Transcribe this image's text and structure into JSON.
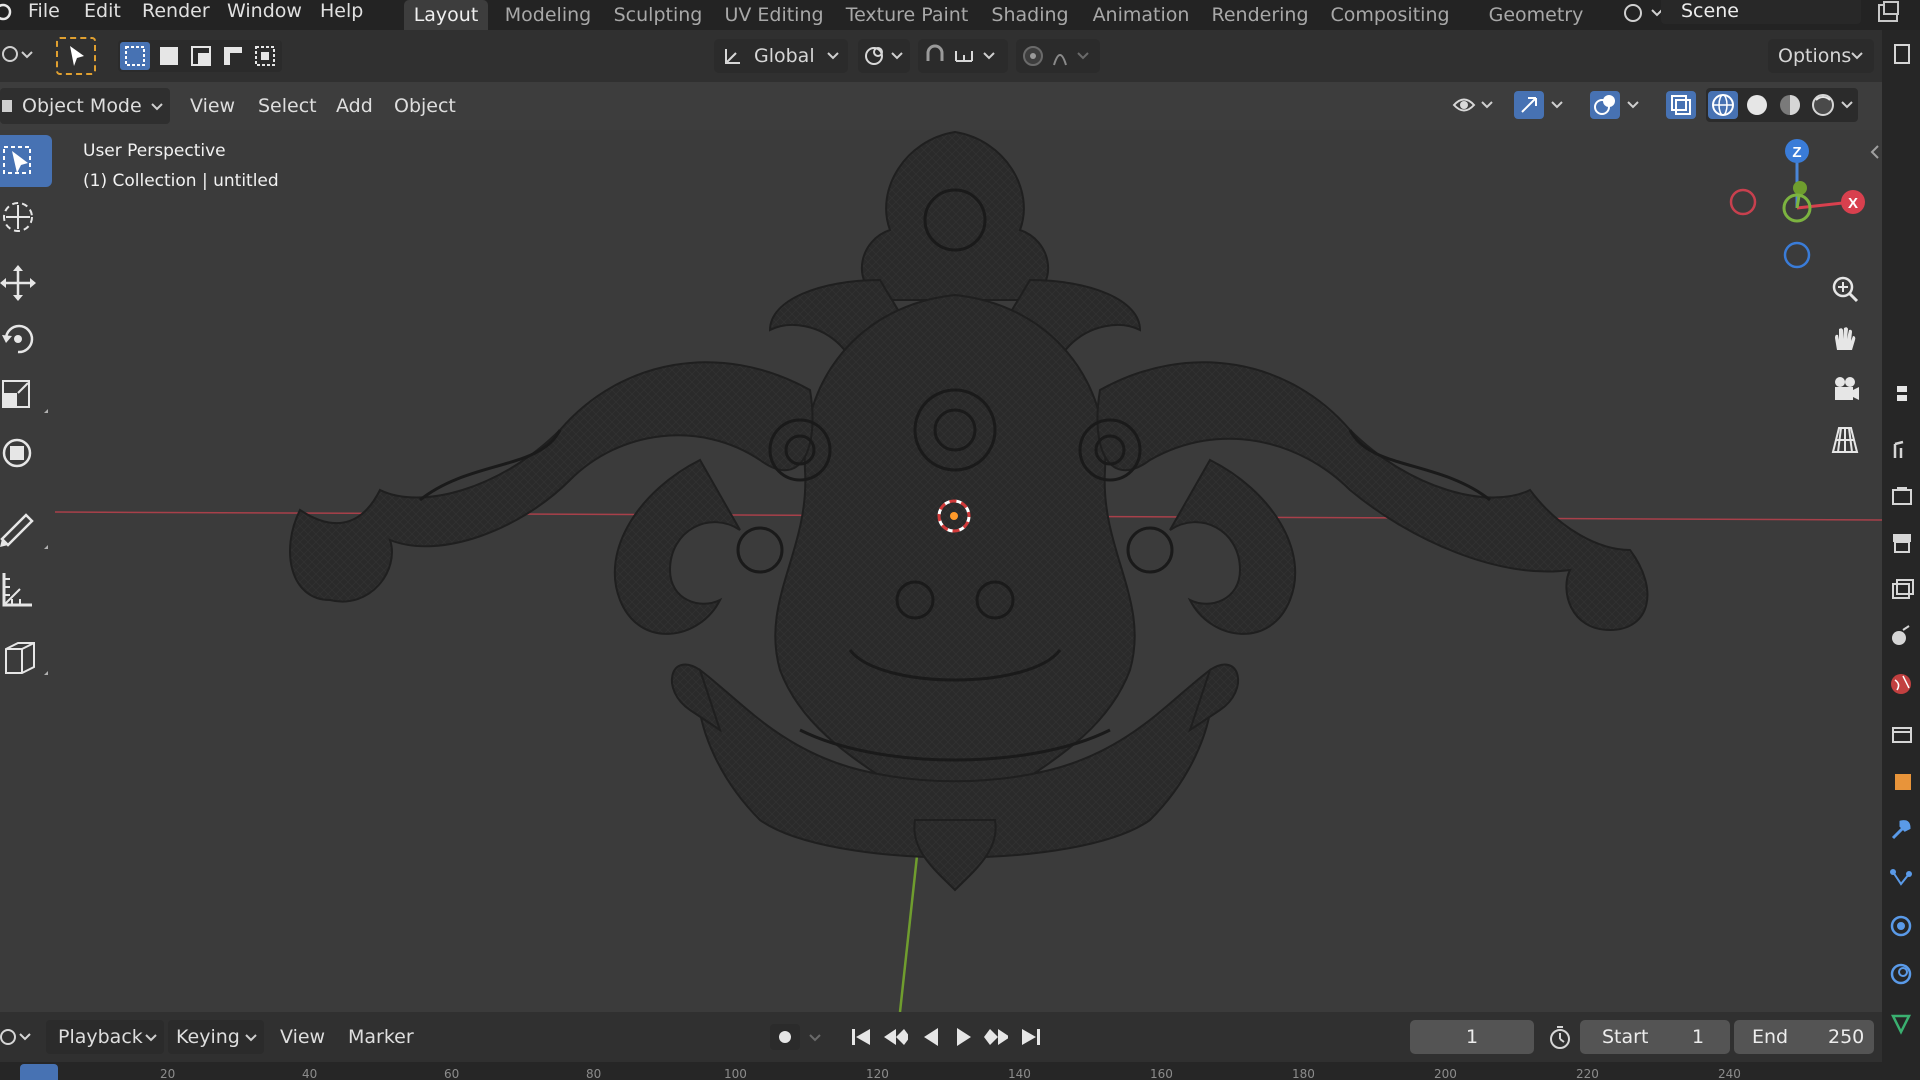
{
  "top_menu": {
    "items": [
      "File",
      "Edit",
      "Render",
      "Window",
      "Help"
    ]
  },
  "workspaces": {
    "tabs": [
      "Layout",
      "Modeling",
      "Sculpting",
      "UV Editing",
      "Texture Paint",
      "Shading",
      "Animation",
      "Rendering",
      "Compositing",
      "Geometry Nod"
    ],
    "active": "Layout"
  },
  "scene": {
    "name": "Scene"
  },
  "tool_header": {
    "orientation_label": "Global",
    "options_label": "Options"
  },
  "viewport_header": {
    "mode_label": "Object Mode",
    "menus": [
      "View",
      "Select",
      "Add",
      "Object"
    ]
  },
  "viewport": {
    "view_name": "User Perspective",
    "collection_label": "(1) Collection | untitled",
    "gizmo": {
      "z_label": "Z",
      "x_label": "X"
    },
    "x_axis_color": "#b23a48",
    "y_axis_color": "#7fb33a"
  },
  "toolbar": {
    "tools": [
      "select-box-icon",
      "cursor-icon",
      "move-icon",
      "rotate-icon",
      "scale-icon",
      "transform-icon",
      "annotate-icon",
      "measure-icon",
      "add-cube-icon"
    ],
    "active": "select-box-icon",
    "accent": "#4772b3"
  },
  "navigation": {
    "buttons": [
      "zoom-icon",
      "pan-hand-icon",
      "camera-icon",
      "grid-projection-icon"
    ]
  },
  "timeline": {
    "menus": [
      "Playback",
      "Keying",
      "View",
      "Marker"
    ],
    "current_frame": "1",
    "start_label": "Start",
    "start_value": "1",
    "end_label": "End",
    "end_value": "250",
    "ruler_numbers": [
      "20",
      "40",
      "60",
      "80",
      "100",
      "120",
      "140",
      "160",
      "180",
      "200",
      "220",
      "240"
    ]
  }
}
